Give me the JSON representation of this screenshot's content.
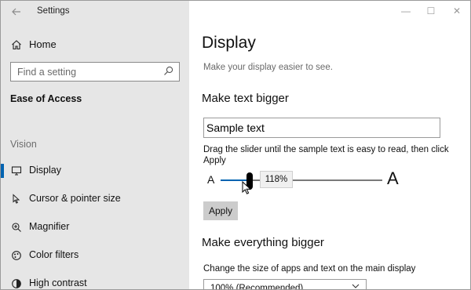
{
  "window": {
    "title": "Settings",
    "controls": {
      "minimize": "—",
      "maximize": "☐",
      "close": "✕"
    }
  },
  "sidebar": {
    "home_label": "Home",
    "search_placeholder": "Find a setting",
    "category": "Ease of Access",
    "group_label": "Vision",
    "items": [
      {
        "label": "Display",
        "icon": "display-icon",
        "selected": true
      },
      {
        "label": "Cursor & pointer size",
        "icon": "cursor-icon",
        "selected": false
      },
      {
        "label": "Magnifier",
        "icon": "magnifier-icon",
        "selected": false
      },
      {
        "label": "Color filters",
        "icon": "color-filters-icon",
        "selected": false
      },
      {
        "label": "High contrast",
        "icon": "high-contrast-icon",
        "selected": false
      }
    ]
  },
  "main": {
    "title": "Display",
    "subtitle": "Make your display easier to see.",
    "text_bigger": {
      "heading": "Make text bigger",
      "sample_text": "Sample text",
      "hint": "Drag the slider until the sample text is easy to read, then click Apply",
      "slider_small_label": "A",
      "slider_large_label": "A",
      "slider_value": "118%",
      "slider_level_percent": 18,
      "apply_label": "Apply"
    },
    "everything_bigger": {
      "heading": "Make everything bigger",
      "hint": "Change the size of apps and text on the main display",
      "dropdown_value": "100% (Recommended)"
    }
  },
  "colors": {
    "sidebar_bg": "#e6e6e6",
    "accent": "#0063b1"
  }
}
